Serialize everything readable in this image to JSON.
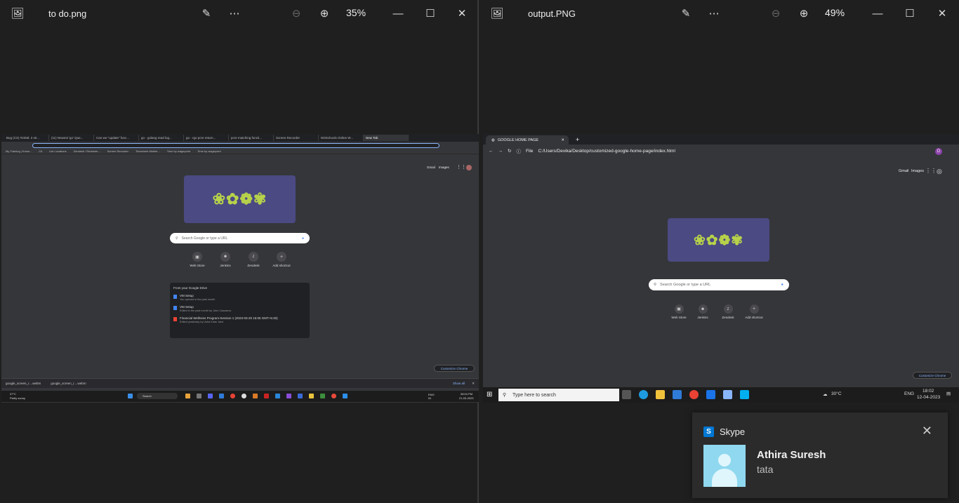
{
  "left_viewer": {
    "file_name": "to do.png",
    "zoom": "35%",
    "shot": {
      "tabs": [
        "Bug (CS) #2258: 2 str...",
        "(11) Newest 'go' Que...",
        "Can we \"update\" func...",
        "go - golang read log...",
        "go - rgo pcre return...",
        "pcre matching functi...",
        "Screen Recorder",
        "W3Schools Online W...",
        "New Tab"
      ],
      "bookmarks": [
        "My Training | Know...",
        "C#",
        "List Locations",
        "Zendesk / Redmine...",
        "Screen Recorder",
        "Timesheet Mobile...",
        "Time by wagepoint",
        "Time by wagepoint"
      ],
      "gmail": "Gmail",
      "images": "Images",
      "search_placeholder": "Search Google or type a URL",
      "shortcuts": [
        "Web Store",
        "Jenkins",
        "Zendesk",
        "Add shortcut"
      ],
      "drive_title": "From your Google Drive",
      "drive_items": [
        {
          "title": "VM Setup",
          "sub": "You opened in the past month"
        },
        {
          "title": "VM Setup",
          "sub": "Edited in the past month by John Cassanos"
        },
        {
          "title": "Financial Wellness Program-Session 1 (2023-03-20 15:05 GMT+5:30)",
          "sub": "Edited yesterday by Usha Kiran Jami"
        }
      ],
      "customize": "Customize Chrome",
      "downloads": [
        "google_screen_r....webm",
        "google_screen_r....webm"
      ],
      "show_all": "Show all",
      "weather_temp": "37°C",
      "weather_desc": "Partly sunny",
      "taskbar_search": "Search",
      "lang": "ENG IN",
      "time": "08:04 PM",
      "date": "21-03-2023"
    }
  },
  "right_viewer": {
    "file_name": "output.PNG",
    "zoom": "49%",
    "shot": {
      "tab_title": "GOOGLE HOME PAGE",
      "file_label": "File",
      "url": "C:/Users/Devika/Desktop/customized-google-home-page/index.html",
      "profile_letter": "D",
      "gmail": "Gmail",
      "images": "Images",
      "search_placeholder": "Search Google or type a URL",
      "shortcuts": [
        "Web Store",
        "Jenkins",
        "Zendesk",
        "Add shortcut"
      ],
      "customize": "Customize Chrome",
      "taskbar_search": "Type here to search",
      "temp": "30°C",
      "lang": "ENG",
      "time": "18:02",
      "date": "12-04-2023"
    }
  },
  "toast": {
    "app_name": "Skype",
    "sender": "Athira Suresh",
    "message": "tata"
  }
}
